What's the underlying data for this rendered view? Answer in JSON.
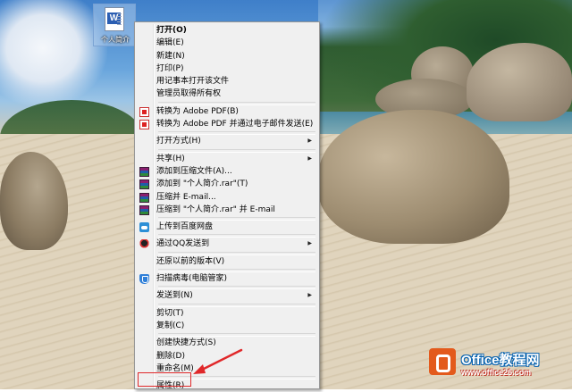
{
  "desktop": {
    "icon_label": "个人简介",
    "icon_glyph": "W"
  },
  "context_menu": {
    "items": [
      {
        "label": "打开(O)",
        "bold": true
      },
      {
        "label": "编辑(E)"
      },
      {
        "label": "新建(N)"
      },
      {
        "label": "打印(P)"
      },
      {
        "label": "用记事本打开该文件"
      },
      {
        "label": "管理员取得所有权"
      },
      {
        "label": "转换为 Adobe PDF(B)",
        "icon": "pdf-icon"
      },
      {
        "label": "转换为 Adobe PDF 并通过电子邮件发送(E)",
        "icon": "pdf-email-icon"
      },
      {
        "label": "打开方式(H)",
        "submenu": true
      },
      {
        "label": "共享(H)",
        "submenu": true
      },
      {
        "label": "添加到压缩文件(A)...",
        "icon": "winrar-icon"
      },
      {
        "label": "添加到 \"个人简介.rar\"(T)",
        "icon": "winrar-icon"
      },
      {
        "label": "压缩并 E-mail...",
        "icon": "winrar-icon"
      },
      {
        "label": "压缩到 \"个人简介.rar\" 并 E-mail",
        "icon": "winrar-icon"
      },
      {
        "label": "上传到百度网盘",
        "icon": "baidu-cloud-icon"
      },
      {
        "label": "通过QQ发送到",
        "icon": "qq-icon",
        "submenu": true
      },
      {
        "label": "还原以前的版本(V)"
      },
      {
        "label": "扫描病毒(电脑管家)",
        "icon": "shield-icon"
      },
      {
        "label": "发送到(N)",
        "submenu": true
      },
      {
        "label": "剪切(T)"
      },
      {
        "label": "复制(C)"
      },
      {
        "label": "创建快捷方式(S)"
      },
      {
        "label": "删除(D)"
      },
      {
        "label": "重命名(M)"
      },
      {
        "label": "属性(R)"
      }
    ],
    "submenu_arrow": "▶"
  },
  "annotation": {
    "highlight_color": "#e0282a"
  },
  "watermark": {
    "title": "Office教程网",
    "url": "www.office26.com"
  }
}
